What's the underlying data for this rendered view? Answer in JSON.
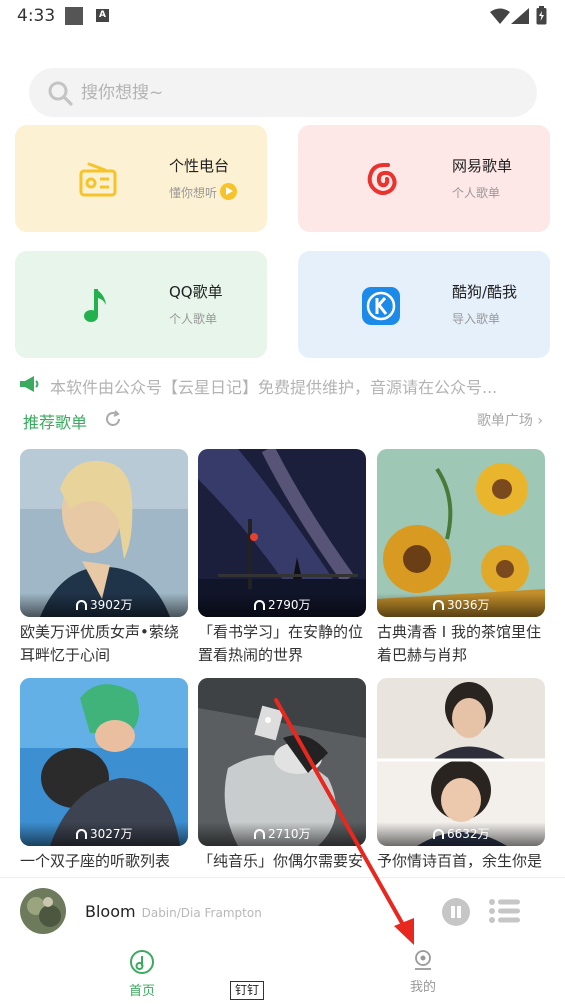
{
  "status_bar": {
    "time": "4:33",
    "a_badge": "A"
  },
  "search": {
    "placeholder": "搜你想搜~"
  },
  "cards": [
    {
      "title": "个性电台",
      "subtitle": "懂你想听",
      "icon": "radio-icon",
      "color": "#f6c32b"
    },
    {
      "title": "网易歌单",
      "subtitle": "个人歌单",
      "icon": "netease-icon",
      "color": "#e8332f"
    },
    {
      "title": "QQ歌单",
      "subtitle": "个人歌单",
      "icon": "music-note-icon",
      "color": "#22b14c"
    },
    {
      "title": "酷狗/酷我",
      "subtitle": "导入歌单",
      "icon": "kugou-icon",
      "color": "#1c8ae8"
    }
  ],
  "notice": {
    "text": "本软件由公众号【云星日记】免费提供维护，音源请在公众号..."
  },
  "recommend": {
    "title": "推荐歌单",
    "more": "歌单广场"
  },
  "playlists": [
    {
      "count": "3902万",
      "title": "欧美万评优质女声•萦绕耳畔忆于心间"
    },
    {
      "count": "2790万",
      "title": "「看书学习」在安静的位置看热闹的世界"
    },
    {
      "count": "3036万",
      "title": "古典清香 I 我的茶馆里住着巴赫与肖邦"
    },
    {
      "count": "3027万",
      "title": "一个双子座的听歌列表"
    },
    {
      "count": "2710万",
      "title": "「纯音乐」你偶尔需要安静的世界"
    },
    {
      "count": "6632万",
      "title": "予你情诗百首，余生你是我的所有"
    }
  ],
  "player": {
    "song": "Bloom",
    "artist": "Dabin/Dia Frampton"
  },
  "nav": {
    "home": "首页",
    "me": "我的"
  },
  "tooltip": "钉钉",
  "colors": {
    "accent": "#3aaa5e",
    "annotation_arrow": "#e8271f"
  }
}
